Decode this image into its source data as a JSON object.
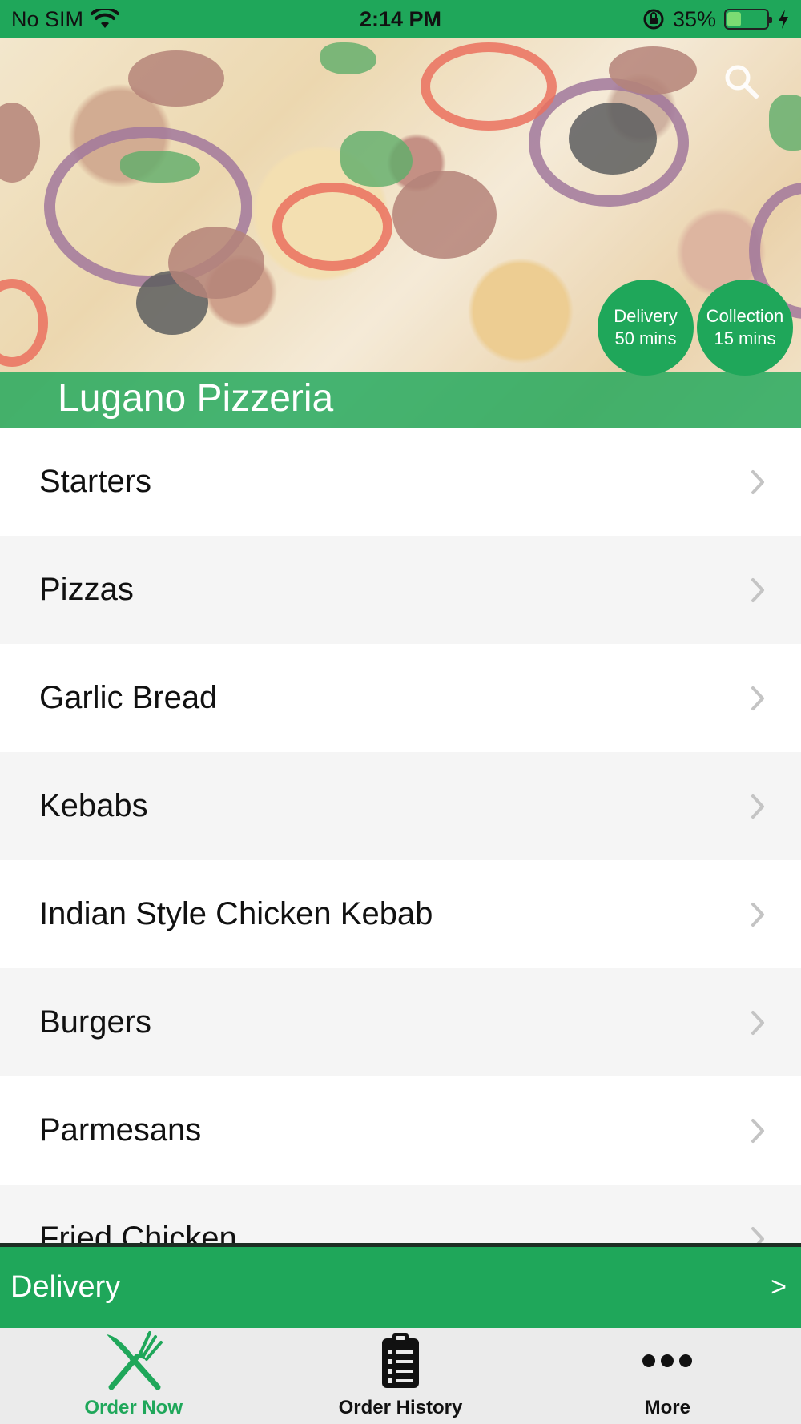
{
  "status_bar": {
    "carrier": "No SIM",
    "time": "2:14 PM",
    "battery_percent": "35%",
    "battery_level": 0.35,
    "icons": [
      "wifi-icon",
      "orientation-lock-icon",
      "battery-icon",
      "charging-bolt-icon"
    ]
  },
  "hero": {
    "restaurant_name": "Lugano Pizzeria",
    "delivery_badge": {
      "label": "Delivery",
      "time": "50 mins"
    },
    "collection_badge": {
      "label": "Collection",
      "time": "15 mins"
    },
    "icons": [
      "search-icon"
    ]
  },
  "menu": {
    "categories": [
      {
        "label": "Starters"
      },
      {
        "label": "Pizzas"
      },
      {
        "label": "Garlic Bread"
      },
      {
        "label": "Kebabs"
      },
      {
        "label": "Indian Style Chicken Kebab"
      },
      {
        "label": "Burgers"
      },
      {
        "label": "Parmesans"
      },
      {
        "label": "Fried Chicken"
      }
    ]
  },
  "delivery_bar": {
    "label": "Delivery",
    "arrow": ">"
  },
  "tab_bar": {
    "tabs": [
      {
        "label": "Order Now",
        "icon": "fork-knife-icon",
        "active": true
      },
      {
        "label": "Order History",
        "icon": "clipboard-icon",
        "active": false
      },
      {
        "label": "More",
        "icon": "more-dots-icon",
        "active": false
      }
    ]
  },
  "colors": {
    "brand_green": "#1fa75a",
    "active_tab": "#1fa75a",
    "row_alt": "#f5f5f5",
    "tab_bar_bg": "#ebebeb"
  }
}
